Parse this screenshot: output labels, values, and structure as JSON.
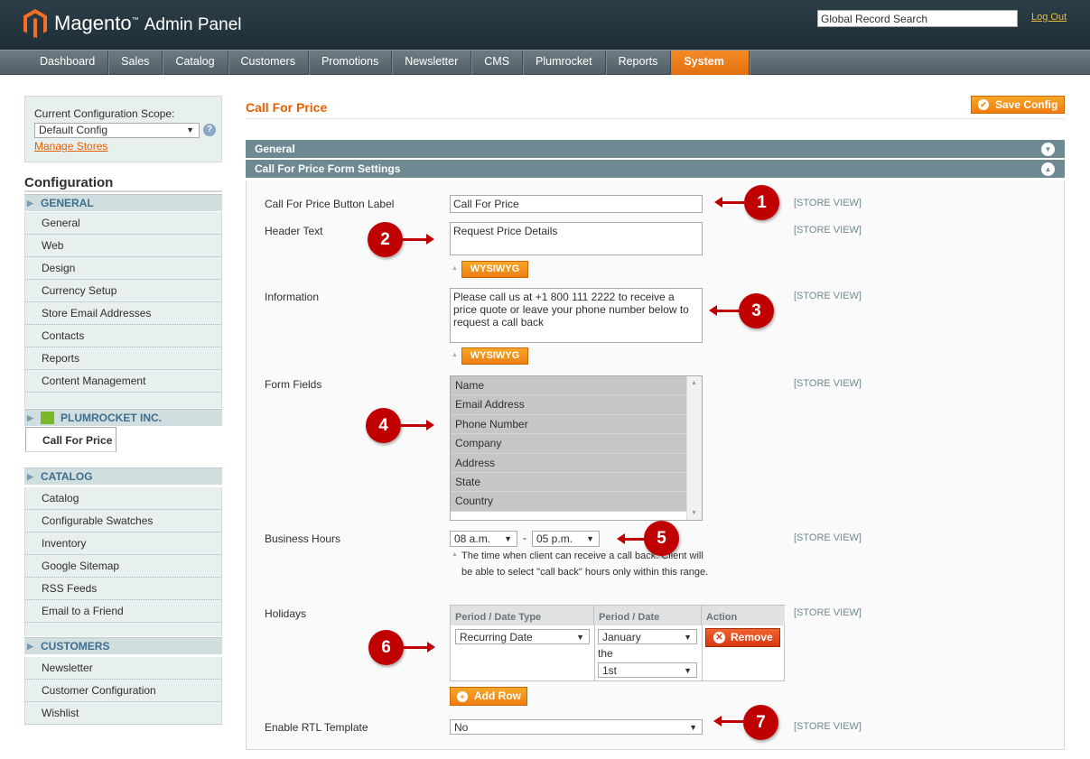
{
  "header": {
    "brand": "Magento",
    "brand_sub": "Admin Panel",
    "search_value": "Global Record Search",
    "logout": "Log Out"
  },
  "nav": [
    "Dashboard",
    "Sales",
    "Catalog",
    "Customers",
    "Promotions",
    "Newsletter",
    "CMS",
    "Plumrocket",
    "Reports",
    "System"
  ],
  "sidebar": {
    "scope_label": "Current Configuration Scope:",
    "scope_value": "Default Config",
    "manage_stores": "Manage Stores",
    "config_title": "Configuration",
    "general_head": "GENERAL",
    "general_items": [
      "General",
      "Web",
      "Design",
      "Currency Setup",
      "Store Email Addresses",
      "Contacts",
      "Reports",
      "Content Management"
    ],
    "plum_head": "PLUMROCKET INC.",
    "plum_items": [
      "Call For Price"
    ],
    "catalog_head": "CATALOG",
    "catalog_items": [
      "Catalog",
      "Configurable Swatches",
      "Inventory",
      "Google Sitemap",
      "RSS Feeds",
      "Email to a Friend"
    ],
    "customers_head": "CUSTOMERS",
    "customers_items": [
      "Newsletter",
      "Customer Configuration",
      "Wishlist"
    ]
  },
  "main": {
    "title": "Call For Price",
    "save_label": "Save Config",
    "section_general": "General",
    "section_form": "Call For Price Form Settings",
    "store_view": "[STORE VIEW]",
    "button_label_label": "Call For Price Button Label",
    "button_label_value": "Call For Price",
    "header_text_label": "Header Text",
    "header_text_value": "Request Price Details",
    "wysiwyg": "WYSIWYG",
    "information_label": "Information",
    "information_value": "Please call us at +1 800 111 2222 to receive a price quote or leave your phone number below to request a call back",
    "form_fields_label": "Form Fields",
    "form_fields": [
      "Name",
      "Email Address",
      "Phone Number",
      "Company",
      "Address",
      "State",
      "Country"
    ],
    "business_hours_label": "Business Hours",
    "hours_from": "08 a.m.",
    "hours_dash": "-",
    "hours_to": "05 p.m.",
    "hours_note": "The time when client can receive a call back. Client will be able to select \"call back\" hours only within this range.",
    "holidays_label": "Holidays",
    "col_type": "Period / Date Type",
    "col_date": "Period / Date",
    "col_action": "Action",
    "row_type": "Recurring Date",
    "row_month": "January",
    "row_the": "the",
    "row_day": "1st",
    "remove": "Remove",
    "add_row": "Add Row",
    "rtl_label": "Enable RTL Template",
    "rtl_value": "No"
  },
  "markers": [
    "1",
    "2",
    "3",
    "4",
    "5",
    "6",
    "7"
  ],
  "colors": {
    "accent": "#eb5e00",
    "marker": "#c00000",
    "section": "#6f8992"
  }
}
